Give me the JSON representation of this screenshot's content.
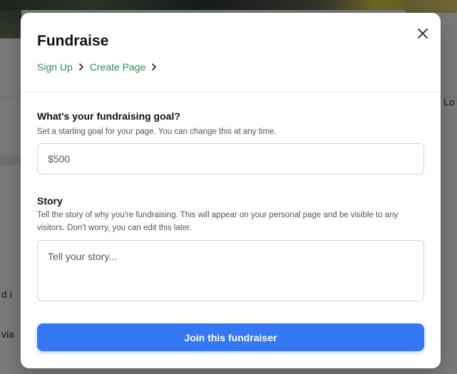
{
  "background": {
    "right_snippet": "Lo",
    "left_snippet_1": "d i",
    "left_snippet_2": "via"
  },
  "modal": {
    "title": "Fundraise",
    "close_icon": "close-icon",
    "breadcrumb": {
      "items": [
        {
          "label": "Sign Up"
        },
        {
          "label": "Create Page"
        }
      ],
      "separator_icon": "chevron-right-icon"
    },
    "goal": {
      "label": "What's your fundraising goal?",
      "help": "Set a starting goal for your page. You can change this at any time.",
      "placeholder": "$500",
      "value": ""
    },
    "story": {
      "label": "Story",
      "help": "Tell the story of why you're fundraising. This will appear on your personal page and be visible to any visitors. Don't worry, you can edit this later.",
      "placeholder": "Tell your story...",
      "value": ""
    },
    "submit_label": "Join this fundraiser"
  },
  "colors": {
    "accent": "#3478f6",
    "link": "#2e8b57",
    "overlay": "rgba(0,0,0,0.52)"
  }
}
